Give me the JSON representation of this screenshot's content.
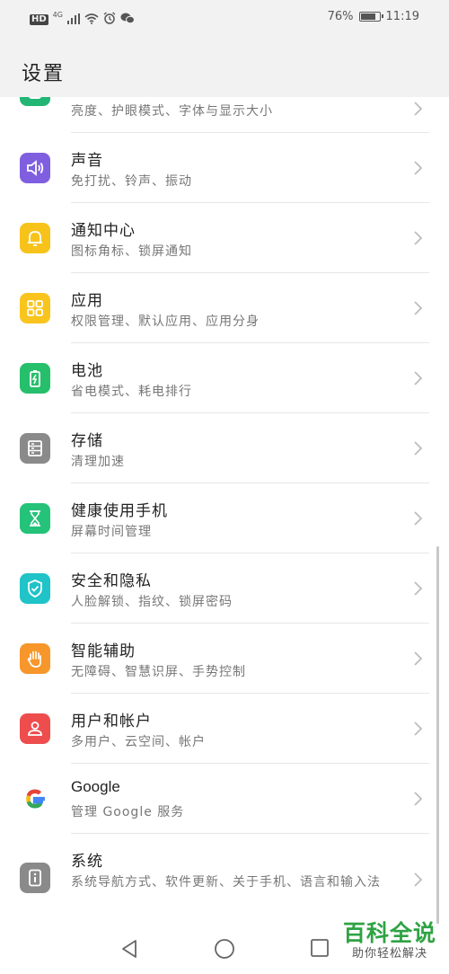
{
  "status_bar": {
    "hd": "HD",
    "network": "4G",
    "battery_percent": "76%",
    "battery_level": 0.76,
    "time": "11:19"
  },
  "header": {
    "title": "设置"
  },
  "settings": [
    {
      "title": "",
      "subtitle": "亮度、护眼模式、字体与显示大小",
      "icon": "display-icon",
      "color": "#22b573"
    },
    {
      "title": "声音",
      "subtitle": "免打扰、铃声、振动",
      "icon": "speaker-icon",
      "color": "#7f5fe0"
    },
    {
      "title": "通知中心",
      "subtitle": "图标角标、锁屏通知",
      "icon": "bell-icon",
      "color": "#f7c31b"
    },
    {
      "title": "应用",
      "subtitle": "权限管理、默认应用、应用分身",
      "icon": "grid-icon",
      "color": "#f9c41d"
    },
    {
      "title": "电池",
      "subtitle": "省电模式、耗电排行",
      "icon": "battery-icon",
      "color": "#26bf6c"
    },
    {
      "title": "存储",
      "subtitle": "清理加速",
      "icon": "storage-icon",
      "color": "#8a8a8a"
    },
    {
      "title": "健康使用手机",
      "subtitle": "屏幕时间管理",
      "icon": "hourglass-icon",
      "color": "#25c27a"
    },
    {
      "title": "安全和隐私",
      "subtitle": "人脸解锁、指纹、锁屏密码",
      "icon": "shield-icon",
      "color": "#1fc3c8"
    },
    {
      "title": "智能辅助",
      "subtitle": "无障碍、智慧识屏、手势控制",
      "icon": "hand-icon",
      "color": "#f7962a"
    },
    {
      "title": "用户和帐户",
      "subtitle": "多用户、云空间、帐户",
      "icon": "user-icon",
      "color": "#ee4d4d"
    },
    {
      "title": "Google",
      "subtitle": "管理 Google 服务",
      "icon": "google-icon",
      "color": "#ffffff"
    },
    {
      "title": "系统",
      "subtitle": "系统导航方式、软件更新、关于手机、语言和输入法",
      "icon": "info-icon",
      "color": "#8a8a8a"
    }
  ],
  "watermark": {
    "big": "百科全说",
    "small": "助你轻松解决"
  }
}
